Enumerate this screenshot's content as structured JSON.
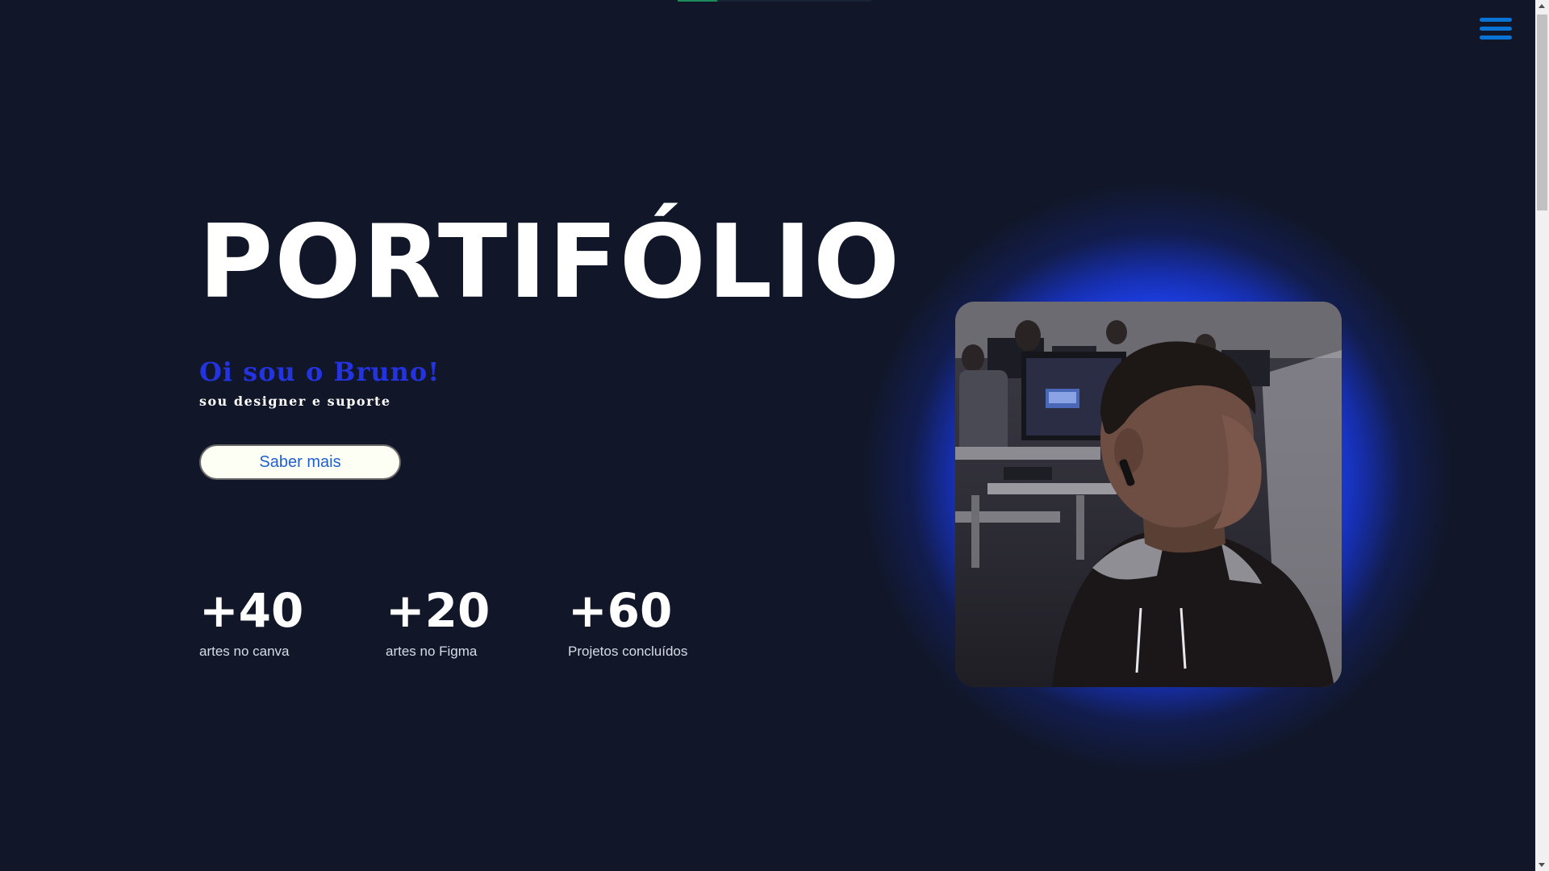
{
  "header": {
    "menu_icon": "hamburger-menu-icon",
    "accent_color": "#0a73d6",
    "scroll_progress": 0.2
  },
  "hero": {
    "title": "PORTIFÓLIO",
    "greeting": "Oi sou o Bruno!",
    "subtitle": "sou designer e suporte",
    "button_label": "Saber mais",
    "greeting_color": "#2433e0"
  },
  "stats": [
    {
      "value": "+40",
      "label": "artes no canva"
    },
    {
      "value": "+20",
      "label": "artes no Figma"
    },
    {
      "value": "+60",
      "label": "Projetos concluídos"
    }
  ],
  "profile_photo": {
    "glow_color": "#1e46ff"
  },
  "colors": {
    "background": "#111729",
    "text": "#ffffff"
  }
}
